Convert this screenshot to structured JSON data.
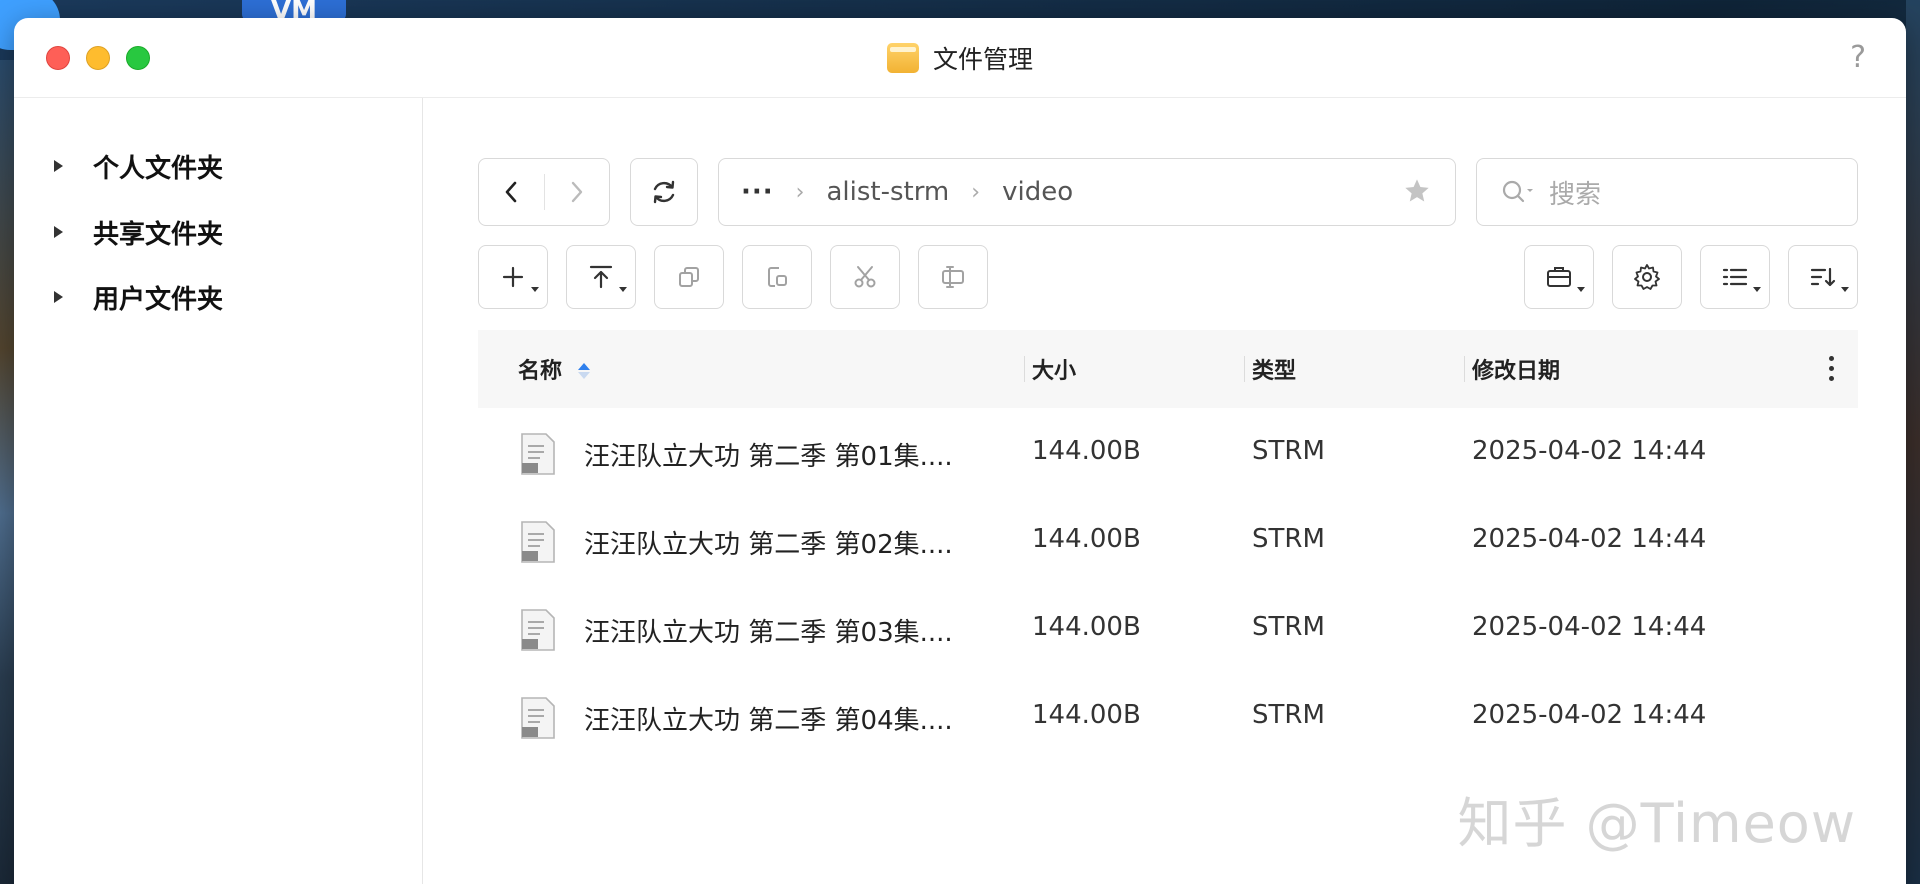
{
  "desktop": {
    "vm_label": "VM"
  },
  "window": {
    "title": "文件管理",
    "help": "?"
  },
  "sidebar": {
    "items": [
      {
        "label": "个人文件夹"
      },
      {
        "label": "共享文件夹"
      },
      {
        "label": "用户文件夹"
      }
    ]
  },
  "path": {
    "dots": "···",
    "crumbs": [
      "alist-strm",
      "video"
    ]
  },
  "search": {
    "placeholder": "搜索"
  },
  "table": {
    "columns": {
      "name": "名称",
      "size": "大小",
      "type": "类型",
      "modified": "修改日期"
    },
    "rows": [
      {
        "name": "汪汪队立大功 第二季 第01集....",
        "size": "144.00B",
        "type": "STRM",
        "modified": "2025-04-02 14:44"
      },
      {
        "name": "汪汪队立大功 第二季 第02集....",
        "size": "144.00B",
        "type": "STRM",
        "modified": "2025-04-02 14:44"
      },
      {
        "name": "汪汪队立大功 第二季 第03集....",
        "size": "144.00B",
        "type": "STRM",
        "modified": "2025-04-02 14:44"
      },
      {
        "name": "汪汪队立大功 第二季 第04集....",
        "size": "144.00B",
        "type": "STRM",
        "modified": "2025-04-02 14:44"
      }
    ]
  },
  "watermark": "知乎 @Timeow",
  "colors": {
    "accent": "#2f80ed",
    "close": "#fe5f57",
    "minimize": "#febc2e",
    "maximize": "#28c840"
  },
  "icons": [
    "back-icon",
    "forward-icon",
    "refresh-icon",
    "star-icon",
    "search-icon",
    "plus-icon",
    "upload-icon",
    "copy-icon",
    "paste-icon",
    "cut-icon",
    "rename-icon",
    "toolbox-icon",
    "gear-icon",
    "list-view-icon",
    "sort-icon",
    "file-icon"
  ]
}
